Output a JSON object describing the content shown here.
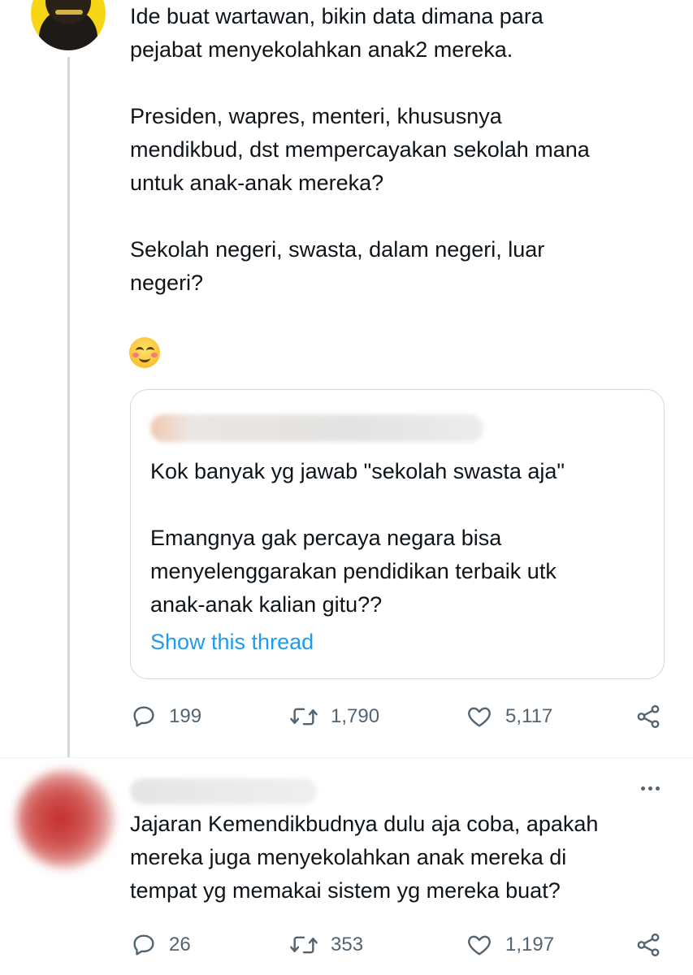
{
  "tweet": {
    "lines": [
      "Ide buat wartawan, bikin data dimana para",
      "pejabat menyekolahkan anak2 mereka.",
      "Presiden, wapres, menteri, khususnya",
      "mendikbud, dst mempercayakan sekolah mana",
      "untuk anak-anak mereka?",
      "Sekolah negeri, swasta, dalam negeri, luar",
      "negeri?"
    ],
    "emoji": "smiling-face-with-smiling-eyes",
    "quote": {
      "lines": [
        "Kok banyak yg jawab \"sekolah swasta aja\"",
        "Emangnya gak percaya negara bisa",
        "menyelenggarakan pendidikan terbaik utk",
        "anak-anak kalian gitu??"
      ],
      "show_thread": "Show this thread"
    },
    "stats": {
      "replies": "199",
      "retweets": "1,790",
      "likes": "5,117"
    }
  },
  "reply": {
    "lines": [
      "Jajaran Kemendikbudnya dulu aja coba, apakah",
      "mereka juga menyekolahkan anak mereka di",
      "tempat yg memakai sistem yg mereka buat?"
    ],
    "stats": {
      "replies": "26",
      "retweets": "353",
      "likes": "1,197"
    }
  },
  "colors": {
    "link": "#1d9bf0",
    "muted": "#536471",
    "text": "#0f1419",
    "border": "#cfd9de"
  }
}
